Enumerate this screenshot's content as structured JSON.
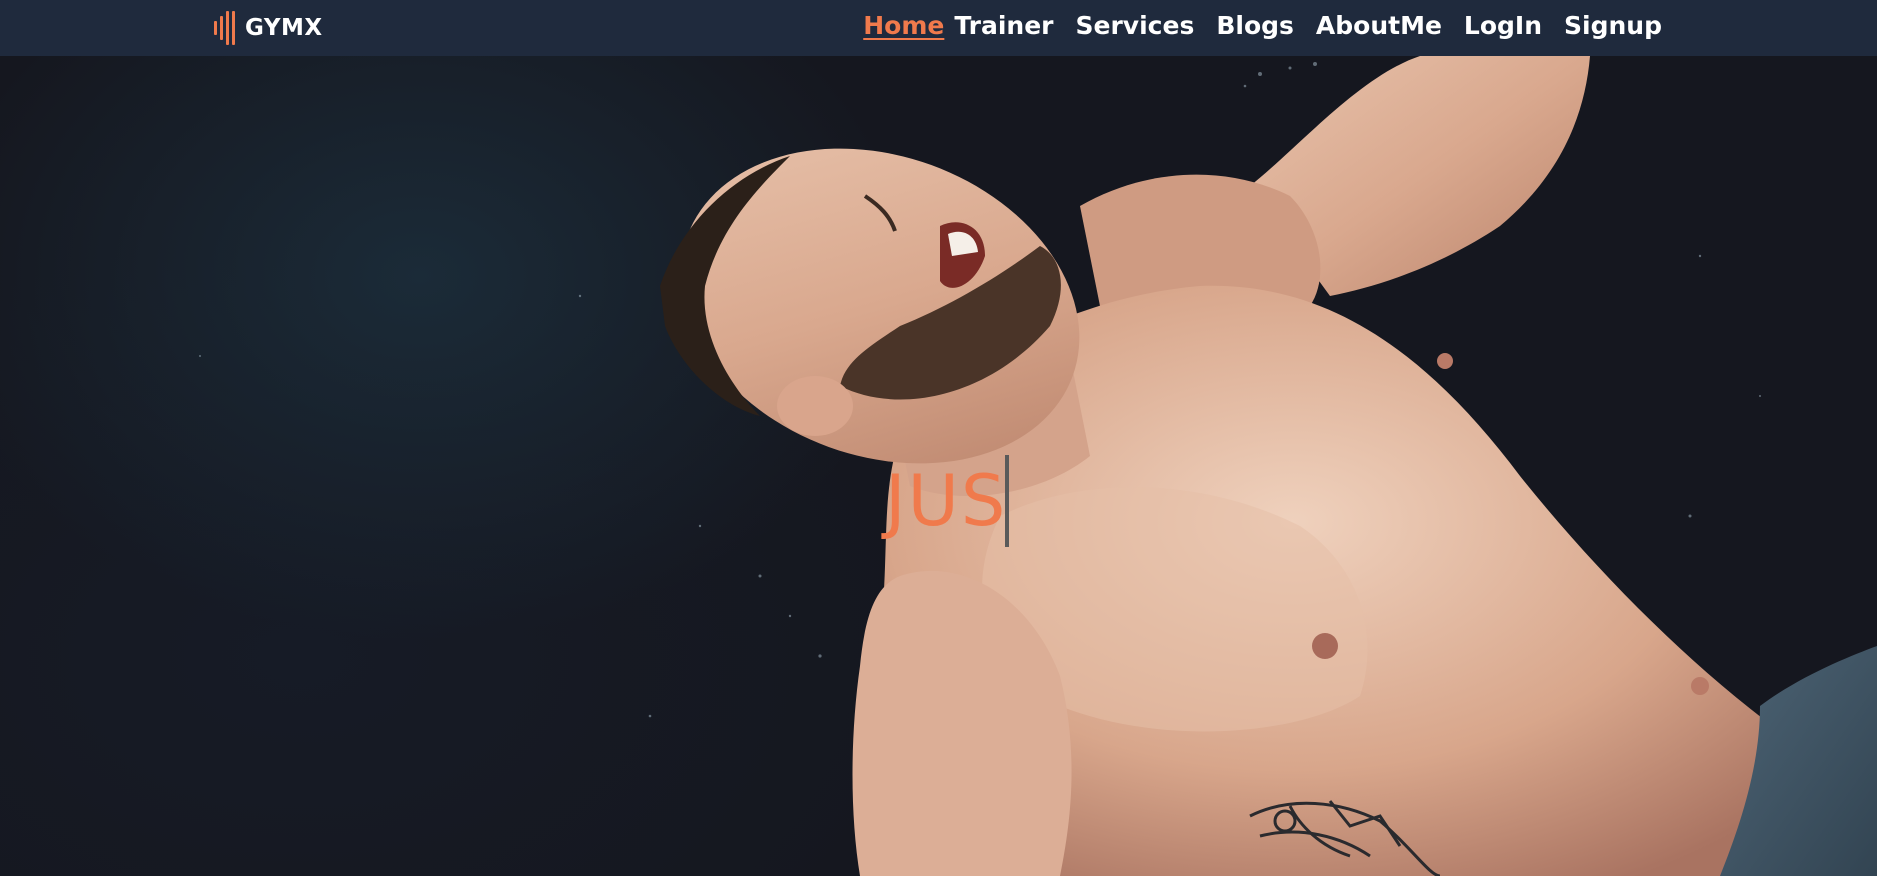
{
  "brand": {
    "name": "GYMX",
    "icon": "equalizer-bars-icon",
    "accent_color": "#f07a4c"
  },
  "nav": {
    "items": [
      {
        "label": "Home",
        "active": true
      },
      {
        "label": "Trainer",
        "active": false
      },
      {
        "label": "Services",
        "active": false
      },
      {
        "label": "Blogs",
        "active": false
      },
      {
        "label": "AboutMe",
        "active": false
      },
      {
        "label": "LogIn",
        "active": false
      },
      {
        "label": "Signup",
        "active": false
      }
    ],
    "background_color": "#1f2a3d",
    "text_color": "#ffffff"
  },
  "hero": {
    "typed_text": "JUS",
    "text_color": "#f07a4c"
  }
}
